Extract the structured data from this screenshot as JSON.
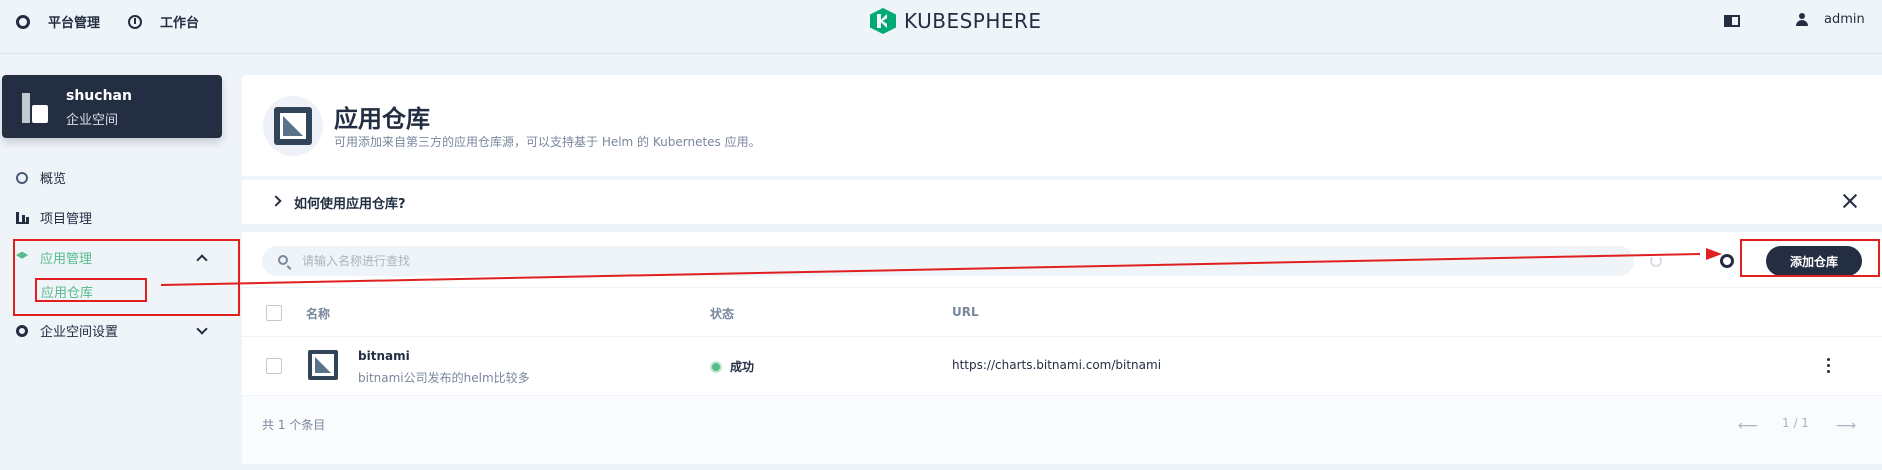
{
  "topbar": {
    "platform_label": "平台管理",
    "workbench_label": "工作台",
    "logo_text": "KUBESPHERE",
    "username": "admin"
  },
  "workspace": {
    "name": "shuchan",
    "subtitle": "企业空间"
  },
  "sidebar": {
    "items": [
      {
        "label": "概览",
        "icon": "dashboard-icon"
      },
      {
        "label": "项目管理",
        "icon": "chart-icon"
      },
      {
        "label": "应用管理",
        "icon": "layers-icon",
        "active": true
      },
      {
        "label": "企业空间设置",
        "icon": "gear-icon"
      }
    ],
    "sub_item": "应用仓库"
  },
  "page": {
    "title": "应用仓库",
    "description": "可用添加来自第三方的应用仓库源，可以支持基于 Helm 的 Kubernetes 应用。",
    "help_text": "如何使用应用仓库?"
  },
  "toolbar": {
    "search_placeholder": "请输入名称进行查找",
    "add_label": "添加仓库"
  },
  "table": {
    "columns": [
      "名称",
      "状态",
      "URL"
    ],
    "rows": [
      {
        "name": "bitnami",
        "description": "bitnami公司发布的helm比较多",
        "status": "成功",
        "url": "https://charts.bitnami.com/bitnami"
      }
    ],
    "total": "共 1 个条目",
    "pagination": "1 / 1"
  },
  "colors": {
    "accent": "#55bc8a",
    "dark": "#242e42",
    "annotation": "#e02020"
  }
}
